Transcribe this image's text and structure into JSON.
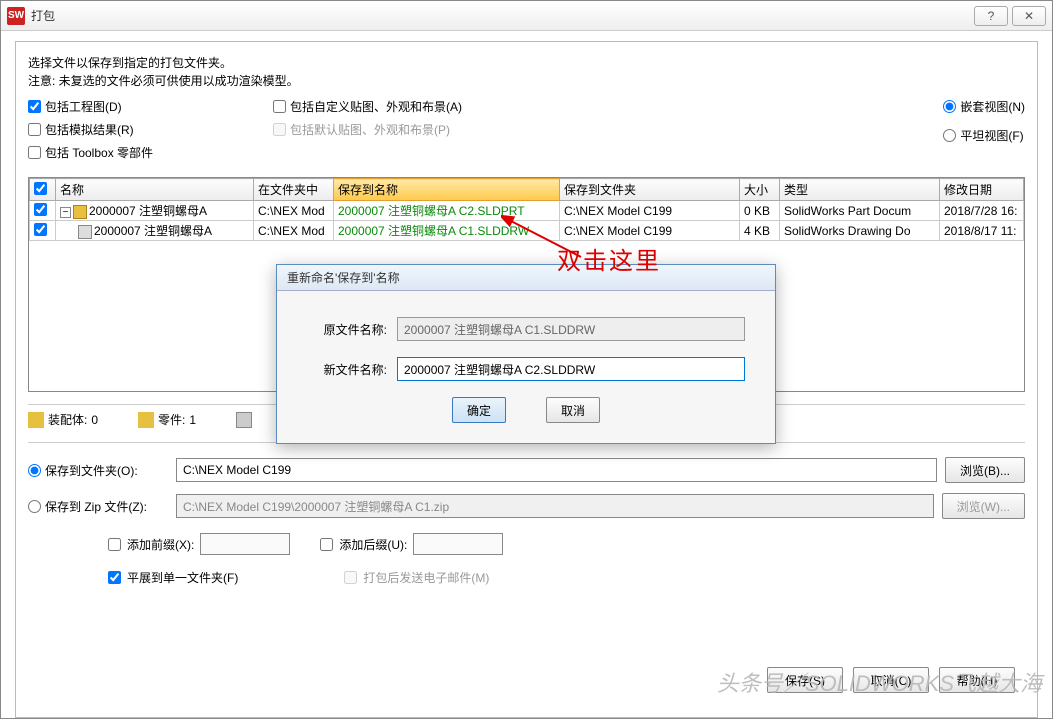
{
  "window": {
    "title": "打包"
  },
  "desc_line1": "选择文件以保存到指定的打包文件夹。",
  "desc_line2": "注意: 未复选的文件必须可供使用以成功渲染模型。",
  "checks": {
    "include_drawings": "包括工程图(D)",
    "include_sim": "包括模拟结果(R)",
    "include_toolbox": "包括 Toolbox 零部件",
    "include_decals": "包括自定义贴图、外观和布景(A)",
    "include_default_decals": "包括默认贴图、外观和布景(P)"
  },
  "view": {
    "nested": "嵌套视图(N)",
    "flat": "平坦视图(F)"
  },
  "table": {
    "headers": {
      "check": "",
      "name": "名称",
      "folder": "在文件夹中",
      "save_name": "保存到名称",
      "save_folder": "保存到文件夹",
      "size": "大小",
      "type": "类型",
      "date": "修改日期"
    },
    "rows": [
      {
        "name": "2000007 注塑铜螺母A",
        "folder": "C:\\NEX Mod",
        "save_name": "2000007 注塑铜螺母A C2.SLDPRT",
        "save_folder": "C:\\NEX Model C199",
        "size": "0 KB",
        "type": "SolidWorks Part Docum",
        "date": "2018/7/28 16:"
      },
      {
        "name": "2000007 注塑铜螺母A",
        "folder": "C:\\NEX Mod",
        "save_name": "2000007 注塑铜螺母A C1.SLDDRW",
        "save_folder": "C:\\NEX Model C199",
        "size": "4 KB",
        "type": "SolidWorks Drawing Do",
        "date": "2018/8/17 11:"
      }
    ]
  },
  "status": {
    "asm_label": "装配体:",
    "asm_count": "0",
    "prt_label": "零件:",
    "prt_count": "1",
    "drw_label": ""
  },
  "save": {
    "folder_label": "保存到文件夹(O):",
    "folder_value": "C:\\NEX Model C199",
    "zip_label": "保存到 Zip 文件(Z):",
    "zip_value": "C:\\NEX Model C199\\2000007 注塑铜螺母A C1.zip",
    "browse": "浏览(B)...",
    "browse_w": "浏览(W)..."
  },
  "suffix": {
    "prefix_label": "添加前缀(X):",
    "suffix_label": "添加后缀(U):",
    "flatten_label": "平展到单一文件夹(F)",
    "email_label": "打包后发送电子邮件(M)"
  },
  "footer": {
    "save": "保存(S)",
    "cancel": "取消(C)",
    "help": "帮助(H)"
  },
  "dialog": {
    "title": "重新命名'保存到'名称",
    "orig_label": "原文件名称:",
    "orig_value": "2000007 注塑铜螺母A C1.SLDDRW",
    "new_label": "新文件名称:",
    "new_value": "2000007 注塑铜螺母A C2.SLDDRW",
    "ok": "确定",
    "cancel": "取消"
  },
  "annot_text": "双击这里",
  "watermark": "头条号／SOLIDWORKS飞越大海"
}
